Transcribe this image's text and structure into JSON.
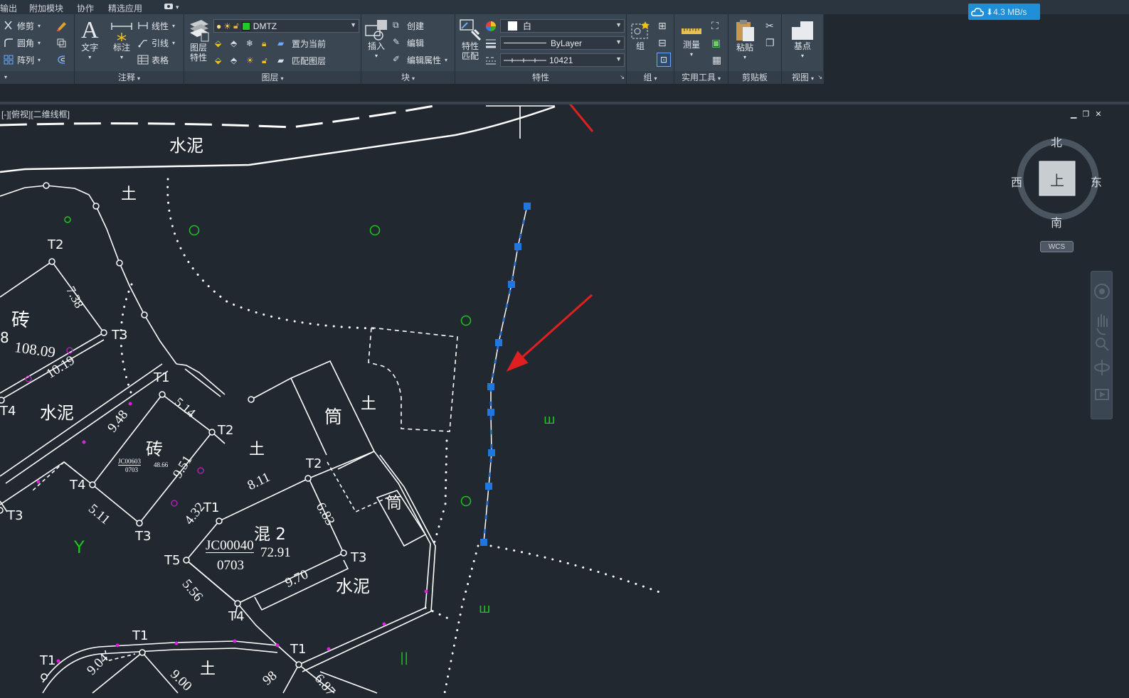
{
  "menubar": {
    "items": [
      "输出",
      "附加模块",
      "协作",
      "精选应用"
    ],
    "extra_caret": "▾"
  },
  "network_speed": "4.3 MB/s",
  "ribbon": {
    "modify": {
      "trim": "修剪",
      "fillet": "圆角",
      "array": "阵列"
    },
    "annotation": {
      "title": "注释",
      "text": "文字",
      "dimension": "标注",
      "linear": "线性",
      "leader": "引线",
      "table": "表格"
    },
    "layers": {
      "title": "图层",
      "layer_properties_line1": "图层",
      "layer_properties_line2": "特性",
      "current_layer": "DMTZ",
      "set_current": "置为当前",
      "match_layer": "匹配图层"
    },
    "block": {
      "title": "块",
      "insert": "插入",
      "create": "创建",
      "edit": "编辑",
      "edit_attributes": "编辑属性"
    },
    "properties": {
      "title": "特性",
      "match_line1": "特性",
      "match_line2": "匹配",
      "color": "白",
      "linetype": "ByLayer",
      "lineweight": "10421"
    },
    "groups": {
      "title": "组",
      "group": "组"
    },
    "utilities": {
      "title": "实用工具",
      "measure": "测量"
    },
    "clipboard": {
      "title": "剪贴板",
      "paste": "粘贴"
    },
    "view": {
      "title": "视图",
      "base": "基点"
    }
  },
  "viewport": {
    "label": "[-][俯视][二维线框]",
    "minimize": "▁",
    "restore": "❐",
    "close": "✕"
  },
  "viewcube": {
    "north": "北",
    "south": "南",
    "west": "西",
    "east": "东",
    "face": "上",
    "wcs": "WCS"
  },
  "drawing": {
    "labels": [
      "水泥",
      "土",
      "T2",
      "7.38",
      "砖",
      "108.09",
      "8",
      "T3",
      "10.19",
      "T4",
      "水泥",
      "T1",
      "5.14",
      "9.48",
      "T2",
      "砖",
      "JC00603",
      "0703",
      "48.66",
      "土",
      "9.51",
      "T4",
      "5.11",
      "T3",
      "T3",
      "筒",
      "土",
      "T2",
      "8.11",
      "T1",
      "6.83",
      "筒",
      "4.32",
      "JC00040",
      "0703",
      "混 2",
      "72.91",
      "T5",
      "T3",
      "5.56",
      "9.70",
      "水泥",
      "T4",
      "T1",
      "T1",
      "T1",
      "9.04",
      "9.00",
      "土",
      "98",
      "6.87",
      "Y",
      "ш",
      "ш",
      "||"
    ]
  },
  "colors": {
    "background": "#212830",
    "ribbon": "#3b4653",
    "drawing_line": "#ffffff",
    "selected_polyline": "#2a6fc9",
    "grip": "#1f77e0",
    "annotation_arrow": "#e02020",
    "green_symbol": "#1fc41f",
    "magenta_point": "#e020e0",
    "layer_swatch": "#22cc22"
  }
}
